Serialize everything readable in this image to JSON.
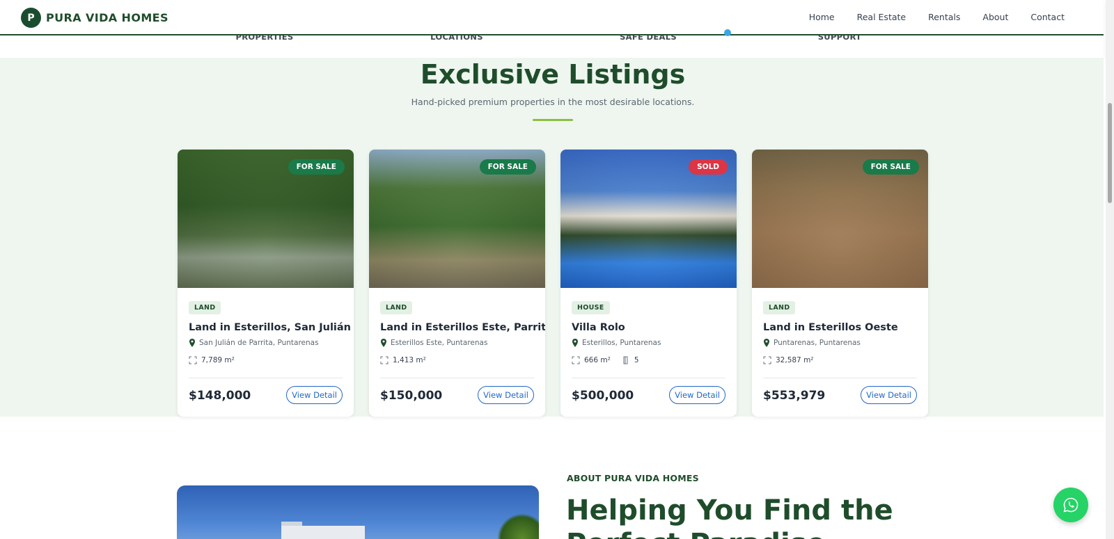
{
  "brand": {
    "initial": "P",
    "name": "PURA VIDA HOMES"
  },
  "nav": [
    "Home",
    "Real Estate",
    "Rentals",
    "About",
    "Contact"
  ],
  "stats": [
    "PROPERTIES",
    "LOCATIONS",
    "SAFE DEALS",
    "SUPPORT"
  ],
  "listings": {
    "title": "Exclusive Listings",
    "subtitle": "Hand-picked premium properties in the most desirable locations.",
    "cards": [
      {
        "badge": "FOR SALE",
        "type": "LAND",
        "title": "Land in Esterillos, San Julián",
        "location": "San Julián de Parrita, Puntarenas",
        "area": "7,789 m²",
        "price": "$148,000",
        "button": "View Detail"
      },
      {
        "badge": "FOR SALE",
        "type": "LAND",
        "title": "Land in Esterillos Este, Parrita",
        "location": "Esterillos Este, Puntarenas",
        "area": "1,413 m²",
        "price": "$150,000",
        "button": "View Detail"
      },
      {
        "badge": "SOLD",
        "type": "HOUSE",
        "title": "Villa Rolo",
        "location": "Esterillos, Puntarenas",
        "area": "666 m²",
        "baths": "5",
        "price": "$500,000",
        "button": "View Detail"
      },
      {
        "badge": "FOR SALE",
        "type": "LAND",
        "title": "Land in Esterillos Oeste",
        "location": "Puntarenas, Puntarenas",
        "area": "32,587 m²",
        "price": "$553,979",
        "button": "View Detail"
      }
    ]
  },
  "about": {
    "eyebrow": "ABOUT PURA VIDA HOMES",
    "heading": "Helping You Find the Perfect Paradise"
  },
  "colors": {
    "primary": "#1f4d2b",
    "accent": "#8bbf3f",
    "sale": "#1a7a4a",
    "sold": "#dc3545",
    "link": "#1f67c9",
    "whatsapp": "#25d366"
  },
  "icons": {
    "pin": "map-pin-icon",
    "area": "expand-icon",
    "bath": "bath-icon",
    "chat": "whatsapp-icon"
  }
}
